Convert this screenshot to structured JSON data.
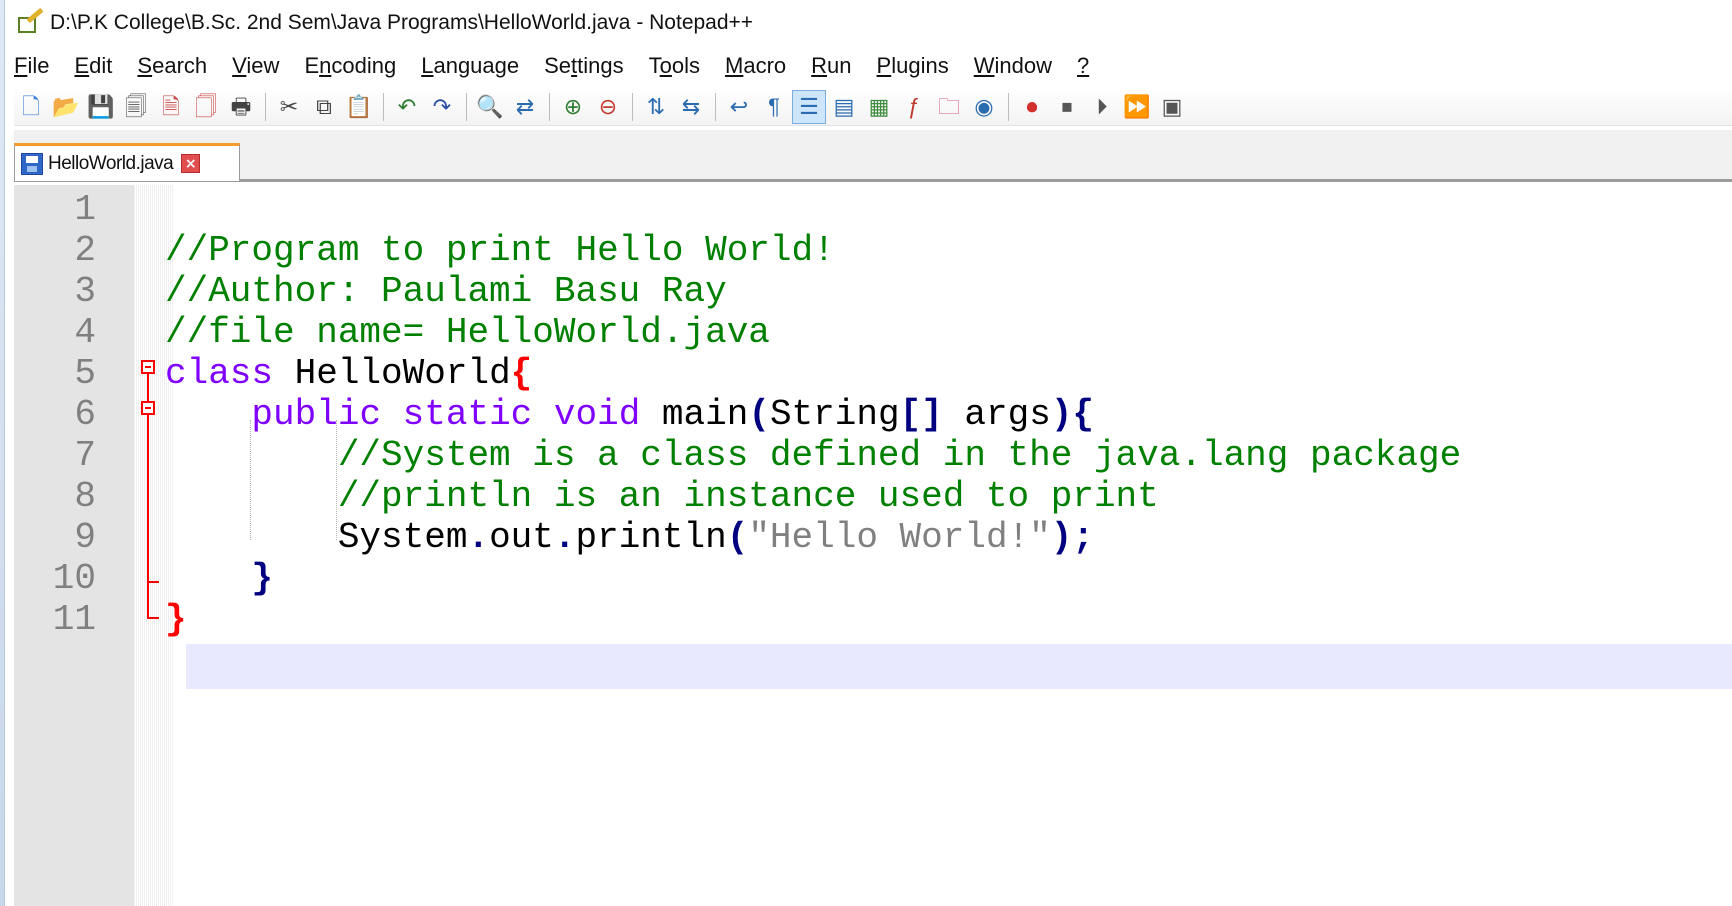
{
  "window": {
    "title": "D:\\P.K College\\B.Sc. 2nd Sem\\Java Programs\\HelloWorld.java - Notepad++"
  },
  "menu": [
    {
      "pre": "",
      "ul": "F",
      "post": "ile"
    },
    {
      "pre": "",
      "ul": "E",
      "post": "dit"
    },
    {
      "pre": "",
      "ul": "S",
      "post": "earch"
    },
    {
      "pre": "",
      "ul": "V",
      "post": "iew"
    },
    {
      "pre": "E",
      "ul": "n",
      "post": "coding"
    },
    {
      "pre": "",
      "ul": "L",
      "post": "anguage"
    },
    {
      "pre": "Se",
      "ul": "t",
      "post": "tings"
    },
    {
      "pre": "T",
      "ul": "o",
      "post": "ols"
    },
    {
      "pre": "",
      "ul": "M",
      "post": "acro"
    },
    {
      "pre": "",
      "ul": "R",
      "post": "un"
    },
    {
      "pre": "",
      "ul": "P",
      "post": "lugins"
    },
    {
      "pre": "",
      "ul": "W",
      "post": "indow"
    },
    {
      "pre": "",
      "ul": "?",
      "post": ""
    }
  ],
  "toolbar": {
    "groups": [
      [
        {
          "name": "new-file-icon",
          "glyph": "🗋",
          "color": "#3b7dd8"
        },
        {
          "name": "open-file-icon",
          "glyph": "📂",
          "color": "#e6a623"
        },
        {
          "name": "save-icon",
          "glyph": "💾",
          "color": "#555555"
        },
        {
          "name": "save-all-icon",
          "glyph": "🗐",
          "color": "#555555"
        },
        {
          "name": "close-icon",
          "glyph": "🗎",
          "color": "#c94a4a"
        },
        {
          "name": "close-all-icon",
          "glyph": "🗍",
          "color": "#c94a4a"
        },
        {
          "name": "print-icon",
          "glyph": "🖶",
          "color": "#444444"
        }
      ],
      [
        {
          "name": "cut-icon",
          "glyph": "✂",
          "color": "#444444"
        },
        {
          "name": "copy-icon",
          "glyph": "⧉",
          "color": "#444444"
        },
        {
          "name": "paste-icon",
          "glyph": "📋",
          "color": "#8a6d3b"
        }
      ],
      [
        {
          "name": "undo-icon",
          "glyph": "↶",
          "color": "#2e7d32"
        },
        {
          "name": "redo-icon",
          "glyph": "↷",
          "color": "#2b4fa0"
        }
      ],
      [
        {
          "name": "find-icon",
          "glyph": "🔍",
          "color": "#333333"
        },
        {
          "name": "replace-icon",
          "glyph": "⇄",
          "color": "#2b6cb0"
        }
      ],
      [
        {
          "name": "zoom-in-icon",
          "glyph": "⊕",
          "color": "#2e7d32"
        },
        {
          "name": "zoom-out-icon",
          "glyph": "⊖",
          "color": "#c0392b"
        }
      ],
      [
        {
          "name": "sync-vertical-icon",
          "glyph": "⇅",
          "color": "#2b6cb0"
        },
        {
          "name": "sync-horizontal-icon",
          "glyph": "⇆",
          "color": "#2b6cb0"
        }
      ],
      [
        {
          "name": "word-wrap-icon",
          "glyph": "↩",
          "color": "#2b6cb0"
        },
        {
          "name": "show-all-chars-icon",
          "glyph": "¶",
          "color": "#2b6cb0"
        },
        {
          "name": "indent-guide-icon",
          "glyph": "☰",
          "color": "#2b6cb0",
          "active": true
        },
        {
          "name": "language-icon",
          "glyph": "▤",
          "color": "#2b6cb0"
        },
        {
          "name": "document-map-icon",
          "glyph": "▦",
          "color": "#3d8c3d"
        },
        {
          "name": "function-list-icon",
          "glyph": "ƒ",
          "color": "#c0392b"
        },
        {
          "name": "folder-workspace-icon",
          "glyph": "🗀",
          "color": "#d65a8a"
        },
        {
          "name": "monitoring-icon",
          "glyph": "◉",
          "color": "#2b6cb0"
        }
      ],
      [
        {
          "name": "record-macro-icon",
          "glyph": "⏺",
          "color": "#d32f2f"
        },
        {
          "name": "stop-macro-icon",
          "glyph": "⏹",
          "color": "#555555"
        },
        {
          "name": "play-macro-icon",
          "glyph": "⏵",
          "color": "#555555"
        },
        {
          "name": "run-macro-multiple-icon",
          "glyph": "⏩",
          "color": "#2b4fa0"
        },
        {
          "name": "save-macro-icon",
          "glyph": "▣",
          "color": "#555555"
        }
      ]
    ]
  },
  "tab": {
    "label": "HelloWorld.java",
    "close_glyph": "×"
  },
  "editor": {
    "lines": [
      {
        "n": "1",
        "tokens": []
      },
      {
        "n": "2",
        "tokens": [
          {
            "t": "//Program to print Hello World!",
            "c": "c-comment"
          }
        ]
      },
      {
        "n": "3",
        "tokens": [
          {
            "t": "//Author: Paulami Basu Ray",
            "c": "c-comment"
          }
        ]
      },
      {
        "n": "4",
        "tokens": [
          {
            "t": "//file name= HelloWorld.java",
            "c": "c-comment"
          }
        ]
      },
      {
        "n": "5",
        "tokens": [
          {
            "t": "class",
            "c": "c-kw"
          },
          {
            "t": " HelloWorld",
            "c": "c-plain"
          },
          {
            "t": "{",
            "c": "c-brace-red"
          }
        ]
      },
      {
        "n": "6",
        "tokens": [
          {
            "t": "    ",
            "c": "c-plain"
          },
          {
            "t": "public",
            "c": "c-kw"
          },
          {
            "t": " ",
            "c": "c-plain"
          },
          {
            "t": "static",
            "c": "c-kw"
          },
          {
            "t": " ",
            "c": "c-plain"
          },
          {
            "t": "void",
            "c": "c-type"
          },
          {
            "t": " main",
            "c": "c-plain"
          },
          {
            "t": "(",
            "c": "c-op"
          },
          {
            "t": "String",
            "c": "c-plain"
          },
          {
            "t": "[]",
            "c": "c-op"
          },
          {
            "t": " args",
            "c": "c-plain"
          },
          {
            "t": "){",
            "c": "c-op"
          }
        ]
      },
      {
        "n": "7",
        "tokens": [
          {
            "t": "        ",
            "c": "c-plain"
          },
          {
            "t": "//System is a class defined in the java.lang package",
            "c": "c-comment"
          }
        ]
      },
      {
        "n": "8",
        "tokens": [
          {
            "t": "        ",
            "c": "c-plain"
          },
          {
            "t": "//println is an instance used to print",
            "c": "c-comment"
          }
        ]
      },
      {
        "n": "9",
        "tokens": [
          {
            "t": "        ",
            "c": "c-plain"
          },
          {
            "t": "System",
            "c": "c-plain"
          },
          {
            "t": ".",
            "c": "c-op"
          },
          {
            "t": "out",
            "c": "c-plain"
          },
          {
            "t": ".",
            "c": "c-op"
          },
          {
            "t": "println",
            "c": "c-plain"
          },
          {
            "t": "(",
            "c": "c-op"
          },
          {
            "t": "\"Hello World!\"",
            "c": "c-string"
          },
          {
            "t": ");",
            "c": "c-op"
          }
        ]
      },
      {
        "n": "10",
        "tokens": [
          {
            "t": "    ",
            "c": "c-plain"
          },
          {
            "t": "}",
            "c": "c-op"
          }
        ]
      },
      {
        "n": "11",
        "tokens": [
          {
            "t": "}",
            "c": "c-brace-red"
          }
        ]
      }
    ]
  }
}
